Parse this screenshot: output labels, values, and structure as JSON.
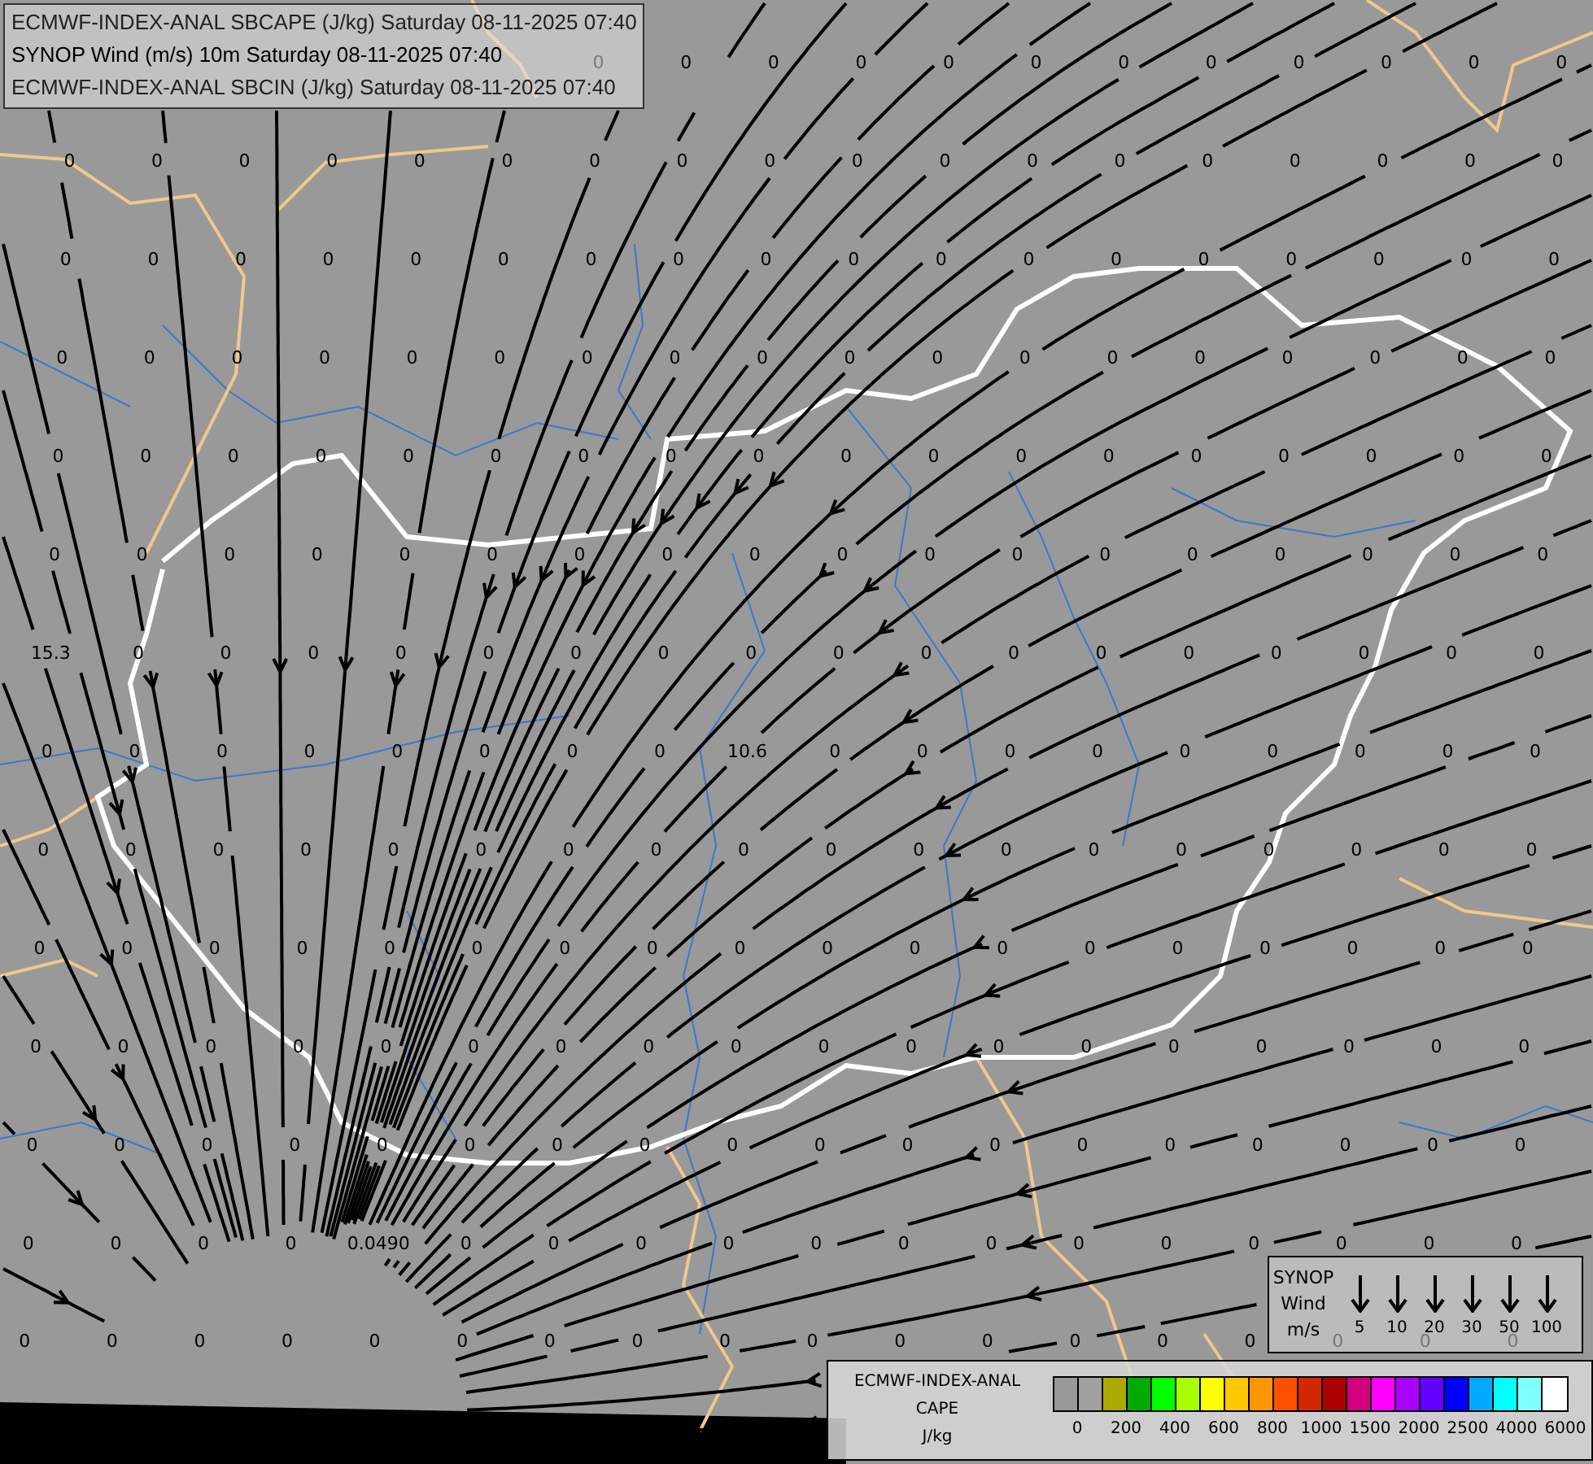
{
  "header_lines": [
    "ECMWF-INDEX-ANAL SBCAPE (J/kg) Saturday 08-11-2025 07:40",
    "SYNOP Wind (m/s) 10m Saturday 08-11-2025 07:40",
    "ECMWF-INDEX-ANAL SBCIN (J/kg) Saturday 08-11-2025 07:40"
  ],
  "cape_values": [
    [
      "0",
      "0",
      "0",
      "0",
      "0",
      "0",
      "0",
      "0",
      "0",
      "0",
      "0",
      "0"
    ],
    [
      "0",
      "0",
      "0",
      "0",
      "0",
      "0",
      "0",
      "0",
      "0",
      "0",
      "0",
      "0",
      "0",
      "0",
      "0",
      "0",
      "0",
      "0"
    ],
    [
      "0",
      "0",
      "0",
      "0",
      "0",
      "0",
      "0",
      "0",
      "0",
      "0",
      "0",
      "0",
      "0",
      "0",
      "0",
      "0",
      "0",
      "0"
    ],
    [
      "0",
      "0",
      "0",
      "0",
      "0",
      "0",
      "0",
      "0",
      "0",
      "0",
      "0",
      "0",
      "0",
      "0",
      "0",
      "0",
      "0",
      "0"
    ],
    [
      "0",
      "0",
      "0",
      "0",
      "0",
      "0",
      "0",
      "0",
      "0",
      "0",
      "0",
      "0",
      "0",
      "0",
      "0",
      "0",
      "0",
      "0"
    ],
    [
      "0",
      "0",
      "0",
      "0",
      "0",
      "0",
      "0",
      "0",
      "0",
      "0",
      "0",
      "0",
      "0",
      "0",
      "0",
      "0",
      "0",
      "0"
    ],
    [
      "15.3",
      "0",
      "0",
      "0",
      "0",
      "0",
      "0",
      "0",
      "0",
      "0",
      "0",
      "0",
      "0",
      "0",
      "0",
      "0",
      "0",
      "0"
    ],
    [
      "0",
      "0",
      "0",
      "0",
      "0",
      "0",
      "0",
      "0",
      "10.6",
      "0",
      "0",
      "0",
      "0",
      "0",
      "0",
      "0",
      "0",
      "0"
    ],
    [
      "0",
      "0",
      "0",
      "0",
      "0",
      "0",
      "0",
      "0",
      "0",
      "0",
      "0",
      "0",
      "0",
      "0",
      "0",
      "0",
      "0",
      "0"
    ],
    [
      "0",
      "0",
      "0",
      "0",
      "0",
      "0",
      "0",
      "0",
      "0",
      "0",
      "0",
      "0",
      "0",
      "0",
      "0",
      "0",
      "0",
      "0"
    ],
    [
      "0",
      "0",
      "0",
      "0",
      "0",
      "0",
      "0",
      "0",
      "0",
      "0",
      "0",
      "0",
      "0",
      "0",
      "0",
      "0",
      "0",
      "0"
    ],
    [
      "0",
      "0",
      "0",
      "0",
      "0",
      "0",
      "0",
      "0",
      "0",
      "0",
      "0",
      "0",
      "0",
      "0",
      "0",
      "0",
      "0",
      "0"
    ],
    [
      "0",
      "0",
      "0",
      "0",
      "0.0490",
      "0",
      "0",
      "0",
      "0",
      "0",
      "0",
      "0",
      "0",
      "0",
      "0",
      "0",
      "0",
      "0"
    ],
    [
      "0",
      "0",
      "0",
      "0",
      "0",
      "0",
      "0",
      "0",
      "0",
      "0",
      "0",
      "0",
      "0",
      "0",
      "0",
      "0",
      "0",
      "0"
    ]
  ],
  "wind_legend": {
    "title_lines": [
      "SYNOP",
      "Wind",
      "m/s"
    ],
    "speeds": [
      "5",
      "10",
      "20",
      "30",
      "50",
      "100"
    ]
  },
  "cape_legend": {
    "title_lines": [
      "ECMWF-INDEX-ANAL",
      "CAPE",
      "J/kg"
    ],
    "swatches": [
      {
        "color": "#999999"
      },
      {
        "color": "#a0a0a0"
      },
      {
        "color": "#aaaa00"
      },
      {
        "color": "#00aa00"
      },
      {
        "color": "#00ff00"
      },
      {
        "color": "#aaff00"
      },
      {
        "color": "#ffff00"
      },
      {
        "color": "#ffc800"
      },
      {
        "color": "#ff9600"
      },
      {
        "color": "#ff5000"
      },
      {
        "color": "#d22800"
      },
      {
        "color": "#aa0000"
      },
      {
        "color": "#d2007d"
      },
      {
        "color": "#ff00ff"
      },
      {
        "color": "#aa00ff"
      },
      {
        "color": "#6400ff"
      },
      {
        "color": "#0000ff"
      },
      {
        "color": "#00aaff"
      },
      {
        "color": "#00ffff"
      },
      {
        "color": "#80ffff"
      },
      {
        "color": "#ffffff"
      }
    ],
    "labels": [
      "0",
      "200",
      "400",
      "600",
      "800",
      "1000",
      "1500",
      "2000",
      "2500",
      "4000",
      "6000"
    ]
  }
}
